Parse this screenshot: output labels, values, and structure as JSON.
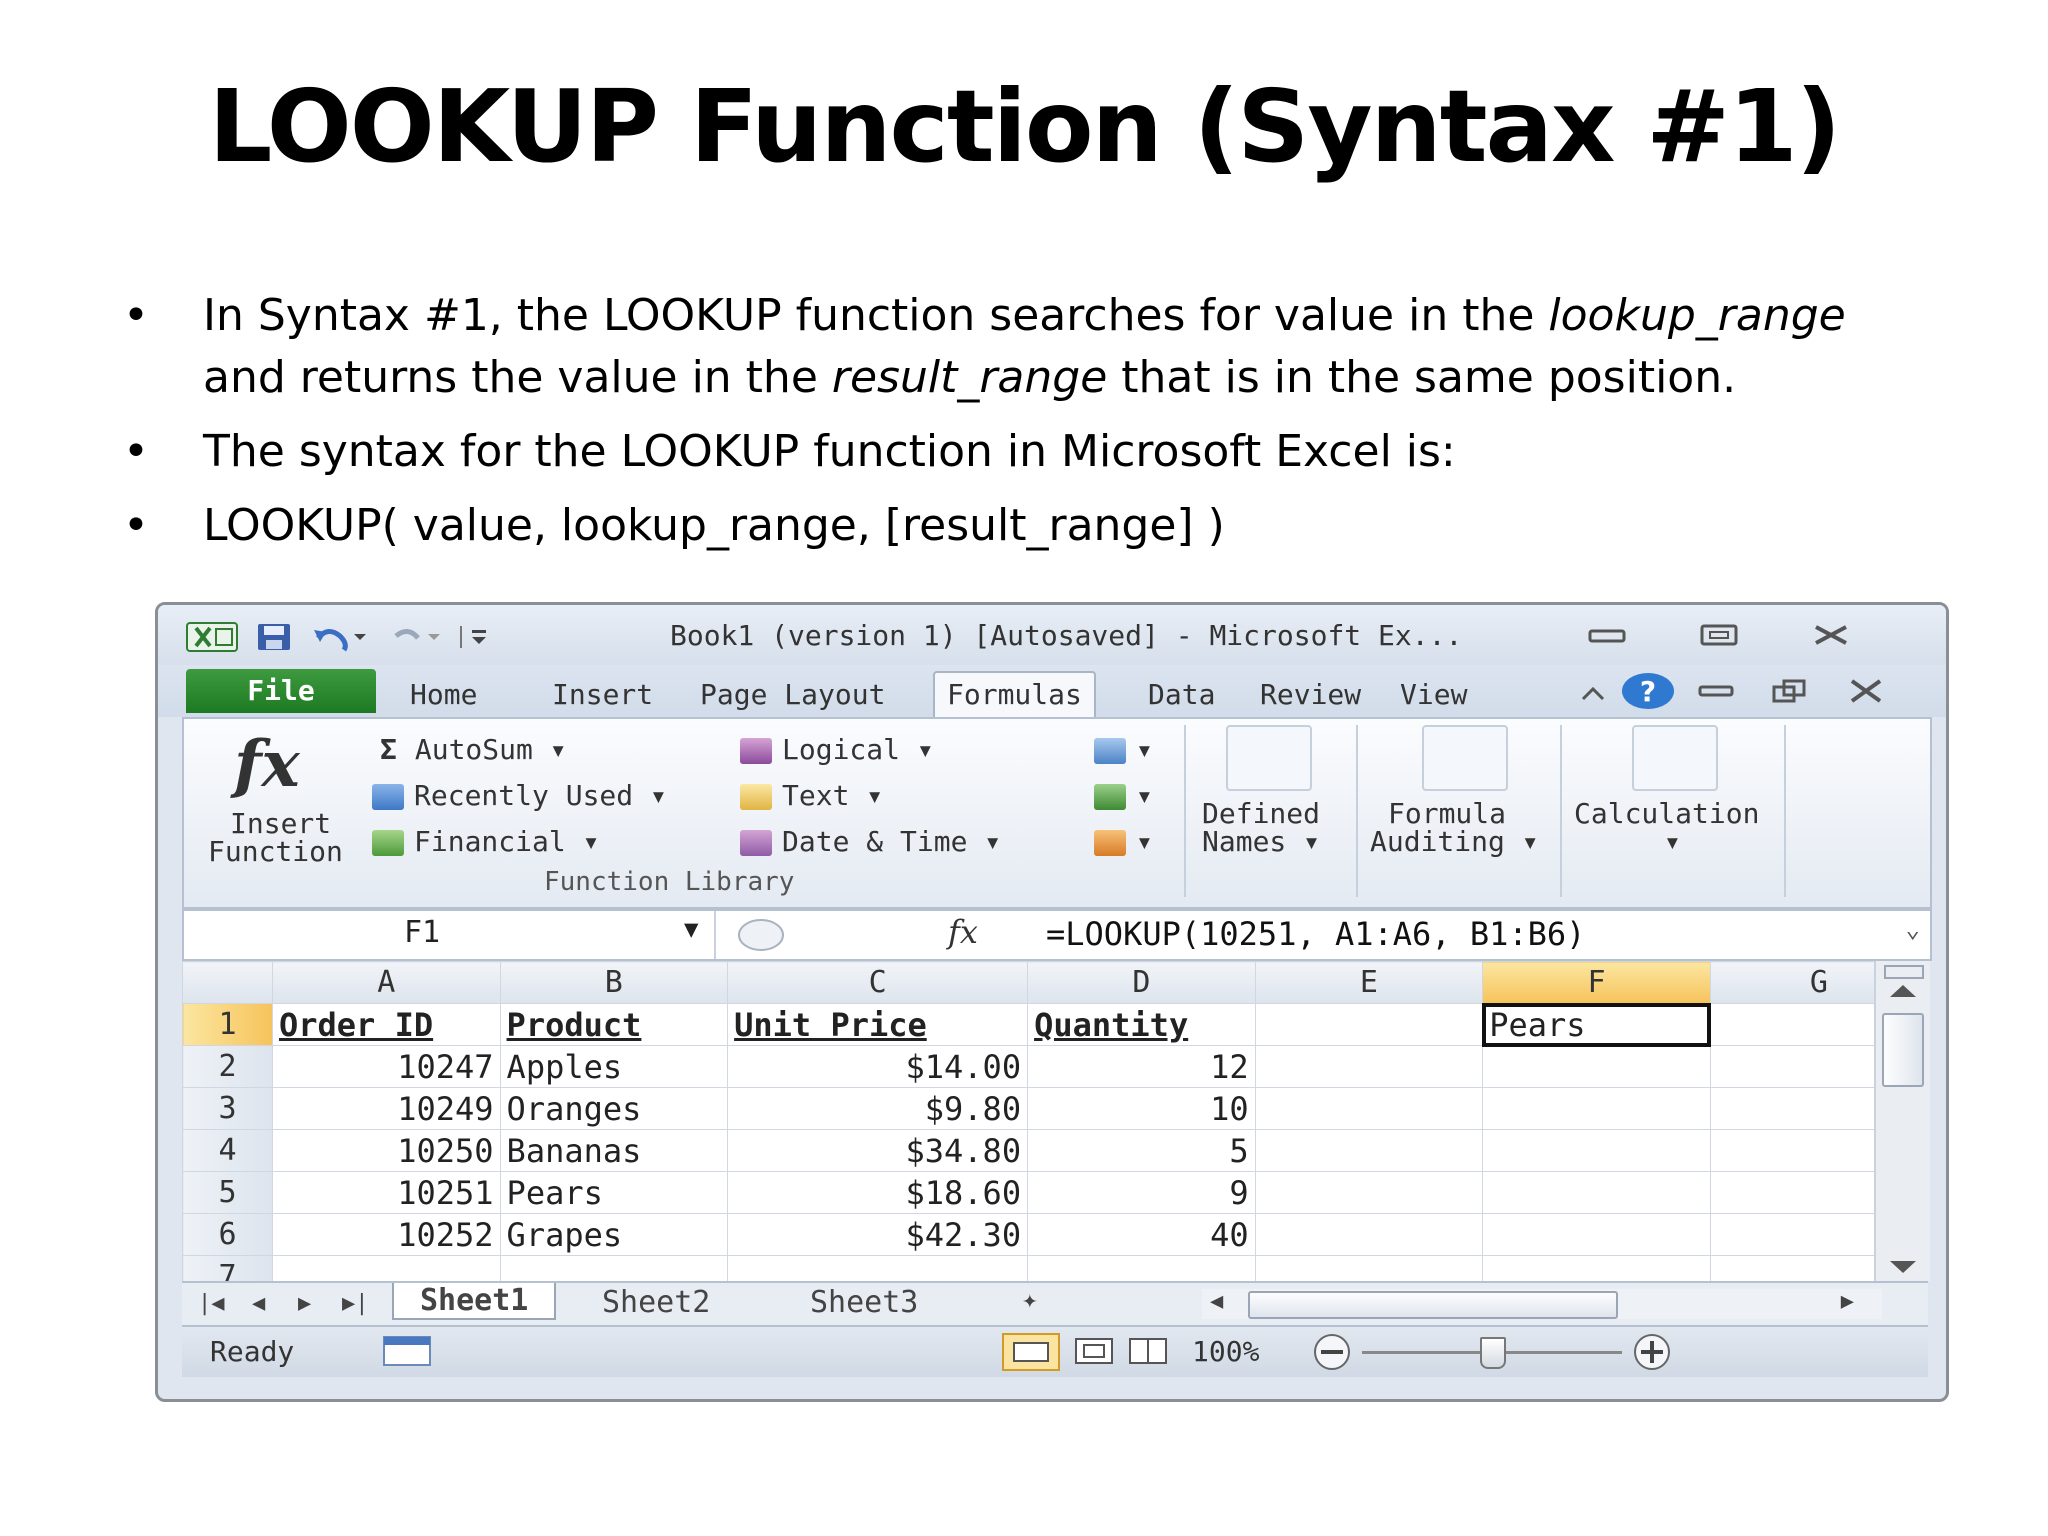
{
  "slide": {
    "title": "LOOKUP Function (Syntax #1)",
    "bullets": {
      "b1_p1": "In Syntax #1, the LOOKUP function searches for value in the ",
      "b1_em1": "lookup_range",
      "b1_p2": " and returns the value in the ",
      "b1_em2": "result_range",
      "b1_p3": " that is in the same position.",
      "b2": "The syntax for the LOOKUP function in Microsoft Excel is:",
      "b3": "LOOKUP( value, lookup_range, [result_range] )",
      "dot": "•"
    }
  },
  "excel": {
    "window_title": "Book1 (version 1) [Autosaved]  -  Microsoft Ex...",
    "tabs": {
      "file": "File",
      "home": "Home",
      "insert": "Insert",
      "page_layout": "Page Layout",
      "formulas": "Formulas",
      "data": "Data",
      "review": "Review",
      "view": "View"
    },
    "ribbon": {
      "insert_function_1": "Insert",
      "insert_function_2": "Function",
      "fx": "fx",
      "autosum": "AutoSum",
      "recently_used": "Recently Used",
      "financial": "Financial",
      "logical": "Logical",
      "text": "Text",
      "date_time": "Date & Time",
      "group_label": "Function Library",
      "defined_names_1": "Defined",
      "defined_names_2": "Names",
      "formula_auditing_1": "Formula",
      "formula_auditing_2": "Auditing",
      "calculation": "Calculation"
    },
    "name_box": "F1",
    "formula_fx": "fx",
    "formula": "=LOOKUP(10251, A1:A6, B1:B6)",
    "columns": [
      "A",
      "B",
      "C",
      "D",
      "E",
      "F",
      "G"
    ],
    "rows": [
      {
        "n": "1",
        "a": "Order ID",
        "b": "Product",
        "c": "Unit Price",
        "d": "Quantity",
        "f": "Pears"
      },
      {
        "n": "2",
        "a": "10247",
        "b": "Apples",
        "c": "$14.00",
        "d": "12"
      },
      {
        "n": "3",
        "a": "10249",
        "b": "Oranges",
        "c": "$9.80",
        "d": "10"
      },
      {
        "n": "4",
        "a": "10250",
        "b": "Bananas",
        "c": "$34.80",
        "d": "5"
      },
      {
        "n": "5",
        "a": "10251",
        "b": "Pears",
        "c": "$18.60",
        "d": "9"
      },
      {
        "n": "6",
        "a": "10252",
        "b": "Grapes",
        "c": "$42.30",
        "d": "40"
      },
      {
        "n": "7"
      }
    ],
    "sheets": [
      "Sheet1",
      "Sheet2",
      "Sheet3"
    ],
    "status": {
      "ready": "Ready",
      "zoom": "100%"
    },
    "colors": {
      "file_tab": "#1e7a22",
      "selected_header": "#f6c35b"
    }
  }
}
